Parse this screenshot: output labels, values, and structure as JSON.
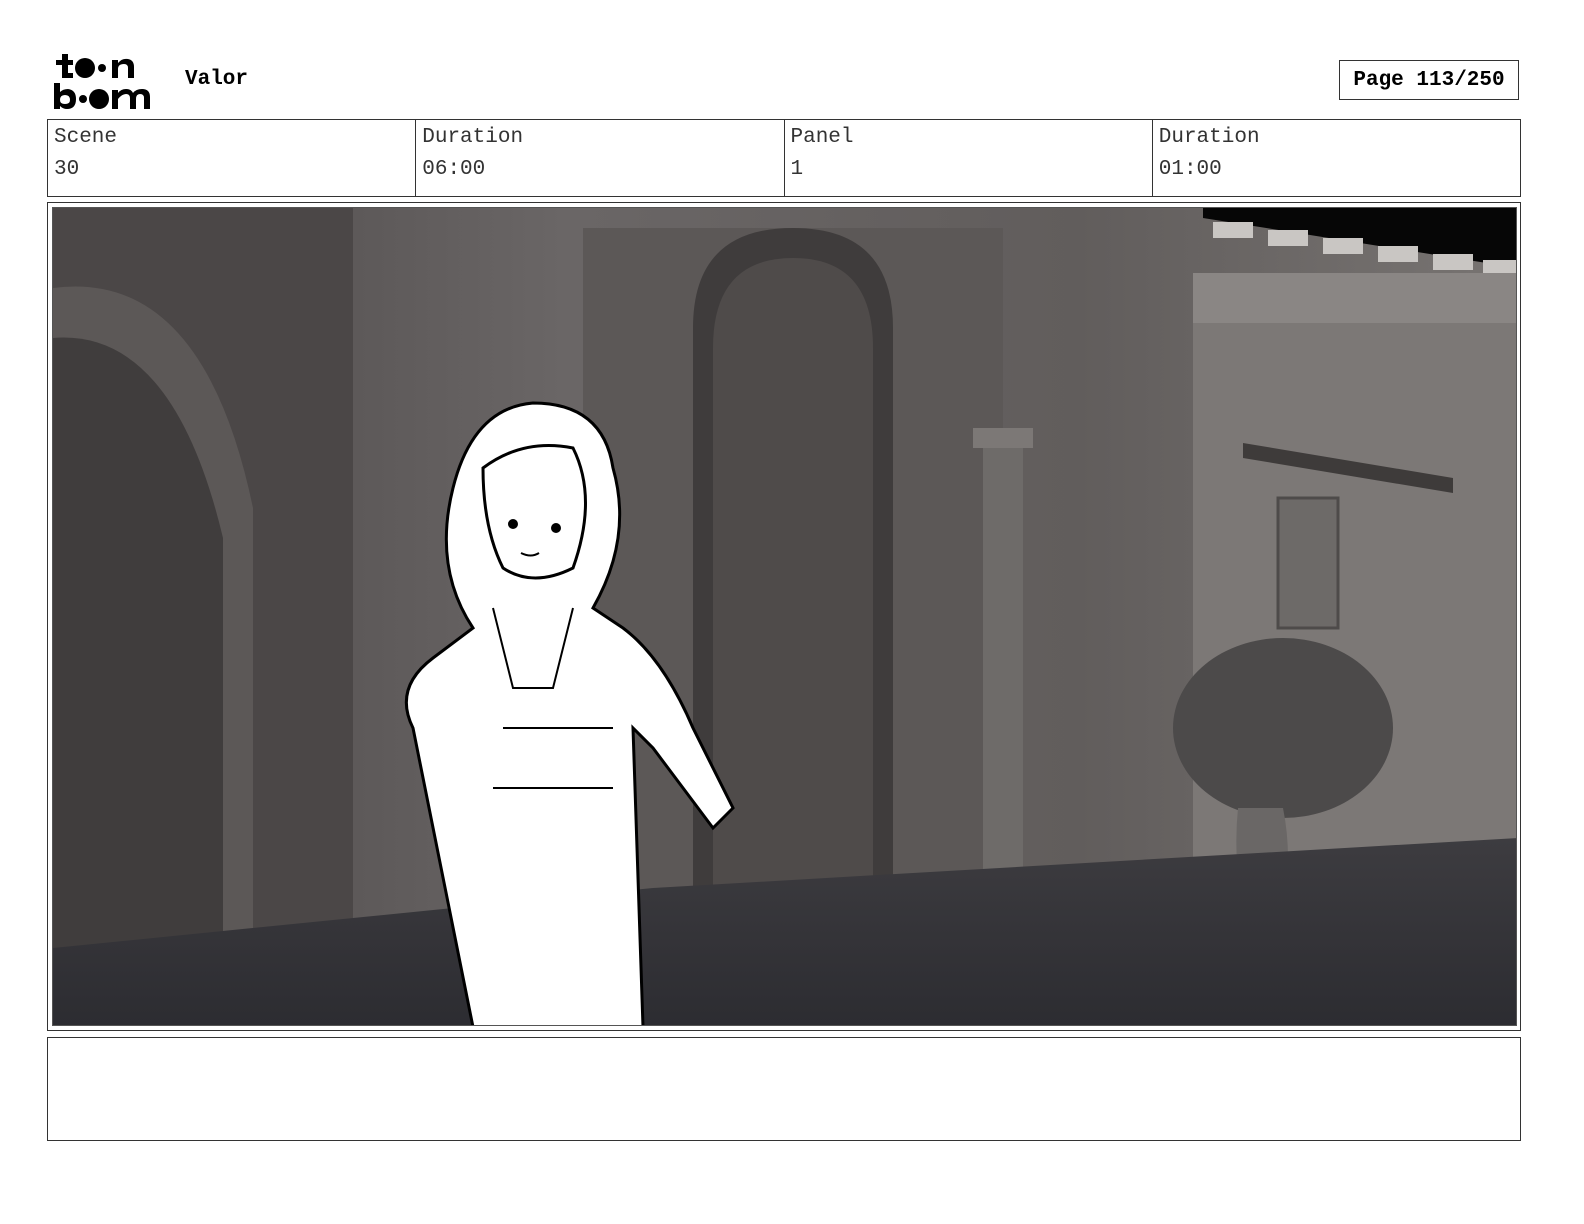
{
  "header": {
    "logo_text": "toon boom",
    "project_title": "Valor",
    "page_label": "Page 113/250"
  },
  "info": {
    "scene_label": "Scene",
    "scene_value": "30",
    "scene_duration_label": "Duration",
    "scene_duration_value": "06:00",
    "panel_label": "Panel",
    "panel_value": "1",
    "panel_duration_label": "Duration",
    "panel_duration_value": "01:00"
  },
  "panel": {
    "image_description_icon": "storyboard-sketch-image"
  },
  "notes": {
    "text": ""
  }
}
